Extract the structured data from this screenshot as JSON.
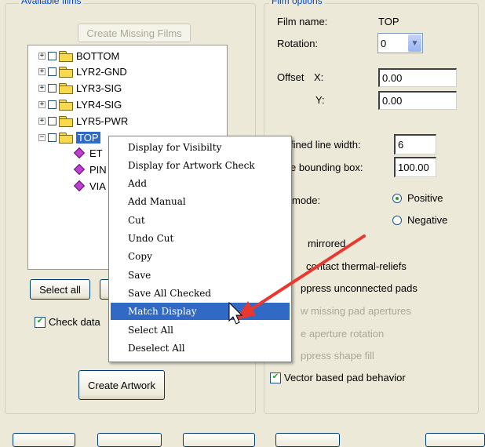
{
  "available_films": {
    "group_title": "Available films",
    "create_missing_label": "Create Missing Films",
    "tree": [
      {
        "label": "BOTTOM",
        "expanded": false
      },
      {
        "label": "LYR2-GND",
        "expanded": false
      },
      {
        "label": "LYR3-SIG",
        "expanded": false
      },
      {
        "label": "LYR4-SIG",
        "expanded": false
      },
      {
        "label": "LYR5-PWR",
        "expanded": false
      },
      {
        "label": "TOP",
        "expanded": true
      }
    ],
    "children_visible": [
      "ET",
      "PIN",
      "VIA"
    ],
    "select_all_label": "Select all",
    "check_database_label": "Check data",
    "create_artwork_label": "Create Artwork"
  },
  "film_options": {
    "group_title": "Film options",
    "film_name_label": "Film name:",
    "film_name_value": "TOP",
    "rotation_label": "Rotation:",
    "rotation_value": "0",
    "offset_label": "Offset",
    "offset_x_label": "X:",
    "offset_x_value": "0.00",
    "offset_y_label": "Y:",
    "offset_y_value": "0.00",
    "undefined_line_width_label": "fined line width:",
    "undefined_line_width_value": "6",
    "bounding_box_label": "e bounding box:",
    "bounding_box_value": "100.00",
    "mode_label": "mode:",
    "positive_label": "Positive",
    "negative_label": "Negative",
    "mirrored_label": "mirrored",
    "contact_thermal_label": "contact thermal-reliefs",
    "suppress_unconnected_label": "ppress unconnected pads",
    "draw_missing_label": "w missing pad apertures",
    "aperture_rotation_label": "e aperture rotation",
    "suppress_shape_fill_label": "ppress shape fill",
    "vector_based_label": "Vector based pad behavior"
  },
  "context_menu": {
    "items": [
      "Display for Visibilty",
      "Display for Artwork Check",
      "Add",
      "Add Manual",
      "Cut",
      "Undo Cut",
      "Copy",
      "Save",
      "Save All Checked",
      "Match Display",
      "Select All",
      "Deselect All"
    ],
    "active_index": 9
  },
  "colors": {
    "window_bg": "#ece9d8",
    "group_title": "#0046d5",
    "selection": "#316ac5",
    "annotation_arrow": "#e8382f"
  }
}
